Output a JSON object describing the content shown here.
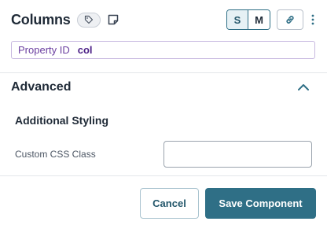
{
  "header": {
    "title": "Columns",
    "size_options": [
      "S",
      "M"
    ],
    "selected_size": "S"
  },
  "property": {
    "label": "Property ID",
    "value": "col"
  },
  "advanced": {
    "title": "Advanced",
    "expanded": true,
    "subsection_title": "Additional Styling",
    "css_class_label": "Custom CSS Class",
    "css_class_value": ""
  },
  "actions": {
    "cancel_label": "Cancel",
    "save_label": "Save Component"
  },
  "colors": {
    "accent": "#2f6f86",
    "property_text": "#6b3fa0"
  },
  "icons": [
    "tag-icon",
    "note-icon",
    "link-icon",
    "more-vertical-icon",
    "chevron-up-icon"
  ]
}
